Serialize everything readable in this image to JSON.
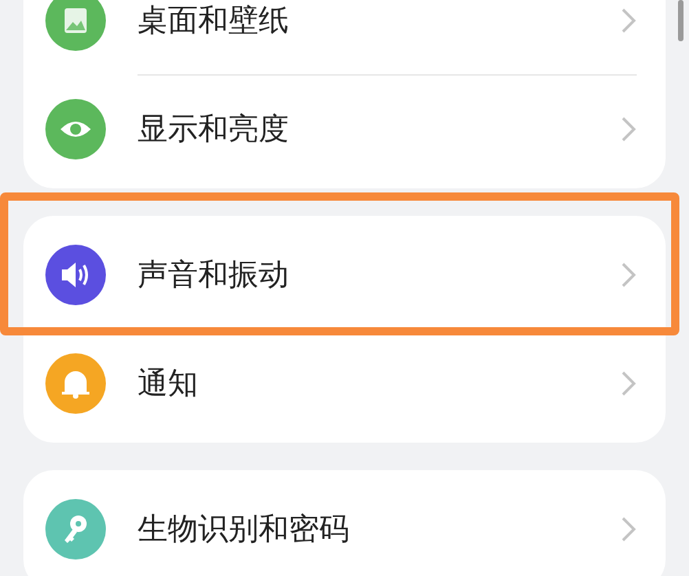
{
  "groups": [
    {
      "continues": false,
      "items": [
        {
          "label": "桌面和壁纸",
          "kind": "picture",
          "color": "#5cb85c",
          "highlighted": false
        },
        {
          "label": "显示和亮度",
          "kind": "eye",
          "color": "#5cb85c",
          "highlighted": false
        }
      ]
    },
    {
      "continues": false,
      "items": [
        {
          "label": "声音和振动",
          "kind": "speaker",
          "color": "#5b4fe0",
          "highlighted": true
        },
        {
          "label": "通知",
          "kind": "bell",
          "color": "#f5a623",
          "highlighted": false
        }
      ]
    },
    {
      "continues": true,
      "items": [
        {
          "label": "生物识别和密码",
          "kind": "key",
          "color": "#5ec4b0",
          "highlighted": false
        }
      ]
    }
  ]
}
